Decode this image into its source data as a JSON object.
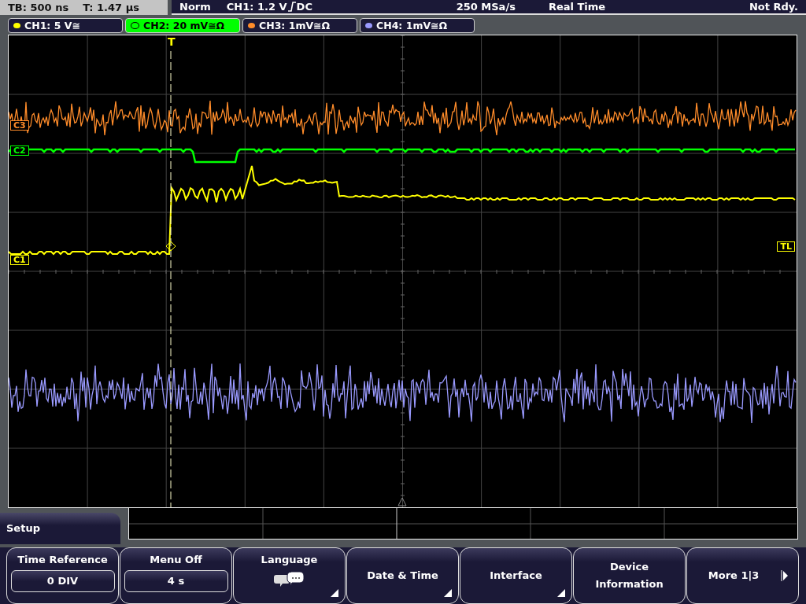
{
  "status_bar": {
    "timebase": "TB: 500 ns",
    "trigger_time": "T: 1.47 µs",
    "trigger_mode": "Norm",
    "trigger_source": "CH1: 1.2 V",
    "coupling": "DC",
    "sample_rate": "250 MSa/s",
    "acquisition": "Real Time",
    "state": "Not Rdy."
  },
  "channels": [
    {
      "label": "CH1: 5 V≅",
      "color": "#ffff00",
      "selected": false
    },
    {
      "label": "CH2: 20 mV≅Ω",
      "color": "#00ff00",
      "selected": true
    },
    {
      "label": "CH3: 1mV≅Ω",
      "color": "#ff8c2a",
      "selected": false
    },
    {
      "label": "CH4: 1mV≅Ω",
      "color": "#9a9aff",
      "selected": false
    }
  ],
  "markers": [
    {
      "label": "C3",
      "color": "#ff8c2a"
    },
    {
      "label": "C2",
      "color": "#00ff00"
    },
    {
      "label": "C1",
      "color": "#ffff00"
    }
  ],
  "trigger_marker": "T",
  "trigger_level_marker": "TL",
  "menu": {
    "title": "Setup",
    "buttons": [
      {
        "kind": "value",
        "label": "Time Reference",
        "value": "0 DIV"
      },
      {
        "kind": "value",
        "label": "Menu Off",
        "value": "4 s"
      },
      {
        "kind": "icon",
        "label": "Language"
      },
      {
        "kind": "submenu",
        "label": "Date & Time"
      },
      {
        "kind": "submenu",
        "label": "Interface"
      },
      {
        "kind": "plain",
        "label": "Device Information"
      },
      {
        "kind": "next",
        "label": "More 1|3"
      }
    ]
  }
}
